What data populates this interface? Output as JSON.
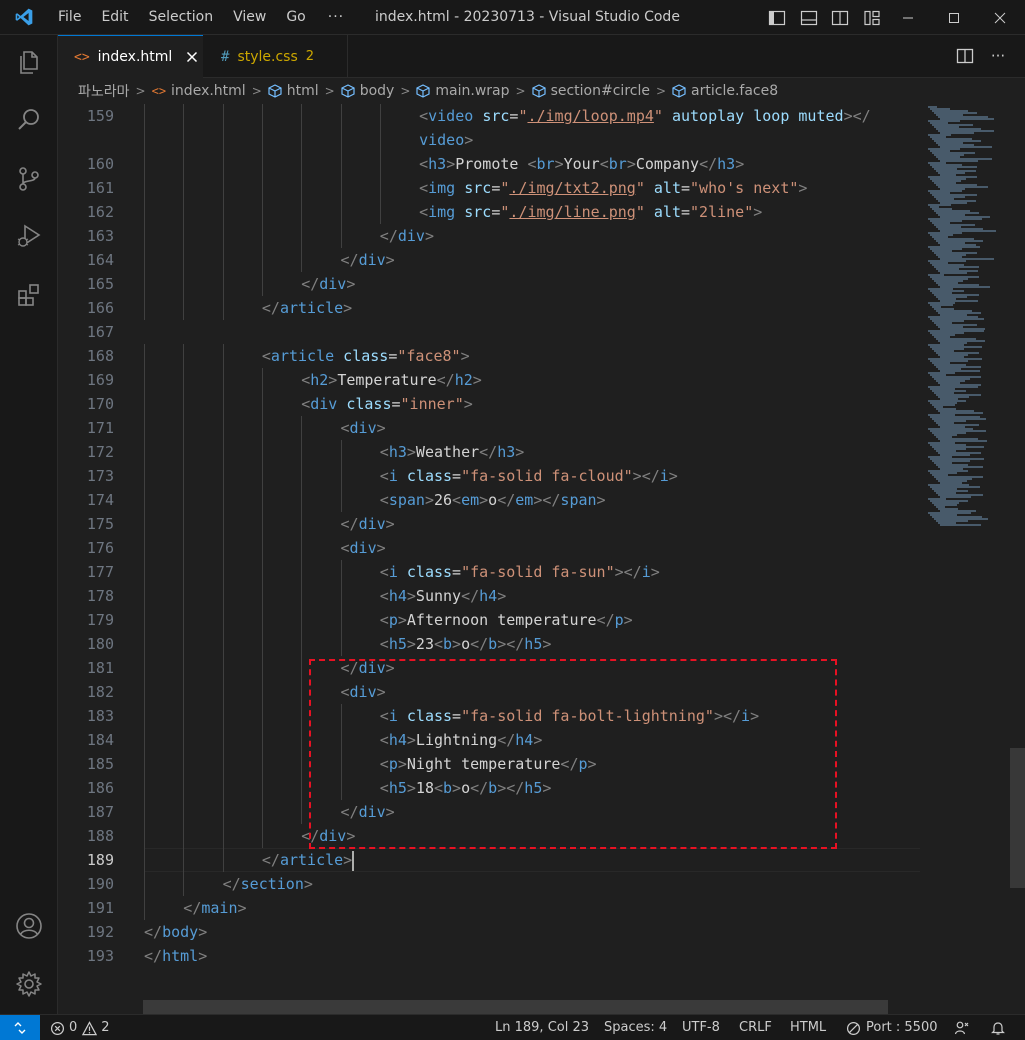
{
  "titlebar": {
    "menu": [
      "File",
      "Edit",
      "Selection",
      "View",
      "Go",
      "···"
    ],
    "title": "index.html - 20230713 - Visual Studio Code"
  },
  "tabs": [
    {
      "icon": "html-file-icon",
      "label": "index.html",
      "active": true
    },
    {
      "icon": "css-file-icon",
      "label": "style.css",
      "badge": "2",
      "active": false
    }
  ],
  "breadcrumb": [
    {
      "label": "파노라마"
    },
    {
      "label": "index.html",
      "icon": "html-file-icon"
    },
    {
      "label": "html",
      "icon": "symbol-element-icon"
    },
    {
      "label": "body",
      "icon": "symbol-element-icon"
    },
    {
      "label": "main.wrap",
      "icon": "symbol-element-icon"
    },
    {
      "label": "section#circle",
      "icon": "symbol-element-icon"
    },
    {
      "label": "article.face8",
      "icon": "symbol-element-icon"
    }
  ],
  "editor": {
    "current_line": "189",
    "lines": [
      {
        "num": "159",
        "indent": 7,
        "tokens": [
          [
            "t-br",
            "<"
          ],
          [
            "t-tag",
            "video"
          ],
          [
            "t-text",
            " "
          ],
          [
            "t-attr",
            "src"
          ],
          [
            "t-text",
            "="
          ],
          [
            "t-str",
            "\""
          ],
          [
            "t-str t-link",
            "./img/loop.mp4"
          ],
          [
            "t-str",
            "\""
          ],
          [
            "t-text",
            " "
          ],
          [
            "t-attr",
            "autoplay"
          ],
          [
            "t-text",
            " "
          ],
          [
            "t-attr",
            "loop"
          ],
          [
            "t-text",
            " "
          ],
          [
            "t-attr",
            "muted"
          ],
          [
            "t-br",
            "></"
          ]
        ]
      },
      {
        "num": "",
        "indent": 7,
        "tokens": [
          [
            "t-tag",
            "video"
          ],
          [
            "t-br",
            ">"
          ]
        ]
      },
      {
        "num": "160",
        "indent": 7,
        "tokens": [
          [
            "t-br",
            "<"
          ],
          [
            "t-tag",
            "h3"
          ],
          [
            "t-br",
            ">"
          ],
          [
            "t-text",
            "Promote "
          ],
          [
            "t-br",
            "<"
          ],
          [
            "t-tag",
            "br"
          ],
          [
            "t-br",
            ">"
          ],
          [
            "t-text",
            "Your"
          ],
          [
            "t-br",
            "<"
          ],
          [
            "t-tag",
            "br"
          ],
          [
            "t-br",
            ">"
          ],
          [
            "t-text",
            "Company"
          ],
          [
            "t-br",
            "</"
          ],
          [
            "t-tag",
            "h3"
          ],
          [
            "t-br",
            ">"
          ]
        ]
      },
      {
        "num": "161",
        "indent": 7,
        "tokens": [
          [
            "t-br",
            "<"
          ],
          [
            "t-tag",
            "img"
          ],
          [
            "t-text",
            " "
          ],
          [
            "t-attr",
            "src"
          ],
          [
            "t-text",
            "="
          ],
          [
            "t-str",
            "\""
          ],
          [
            "t-str t-link",
            "./img/txt2.png"
          ],
          [
            "t-str",
            "\""
          ],
          [
            "t-text",
            " "
          ],
          [
            "t-attr",
            "alt"
          ],
          [
            "t-text",
            "="
          ],
          [
            "t-str",
            "\"who's next\""
          ],
          [
            "t-br",
            ">"
          ]
        ]
      },
      {
        "num": "162",
        "indent": 7,
        "tokens": [
          [
            "t-br",
            "<"
          ],
          [
            "t-tag",
            "img"
          ],
          [
            "t-text",
            " "
          ],
          [
            "t-attr",
            "src"
          ],
          [
            "t-text",
            "="
          ],
          [
            "t-str",
            "\""
          ],
          [
            "t-str t-link",
            "./img/line.png"
          ],
          [
            "t-str",
            "\""
          ],
          [
            "t-text",
            " "
          ],
          [
            "t-attr",
            "alt"
          ],
          [
            "t-text",
            "="
          ],
          [
            "t-str",
            "\"2line\""
          ],
          [
            "t-br",
            ">"
          ]
        ]
      },
      {
        "num": "163",
        "indent": 6,
        "tokens": [
          [
            "t-br",
            "</"
          ],
          [
            "t-tag",
            "div"
          ],
          [
            "t-br",
            ">"
          ]
        ]
      },
      {
        "num": "164",
        "indent": 5,
        "tokens": [
          [
            "t-br",
            "</"
          ],
          [
            "t-tag",
            "div"
          ],
          [
            "t-br",
            ">"
          ]
        ]
      },
      {
        "num": "165",
        "indent": 4,
        "tokens": [
          [
            "t-br",
            "</"
          ],
          [
            "t-tag",
            "div"
          ],
          [
            "t-br",
            ">"
          ]
        ]
      },
      {
        "num": "166",
        "indent": 3,
        "tokens": [
          [
            "t-br",
            "</"
          ],
          [
            "t-tag",
            "article"
          ],
          [
            "t-br",
            ">"
          ]
        ]
      },
      {
        "num": "167",
        "indent": 0,
        "tokens": []
      },
      {
        "num": "168",
        "indent": 3,
        "tokens": [
          [
            "t-br",
            "<"
          ],
          [
            "t-tag",
            "article"
          ],
          [
            "t-text",
            " "
          ],
          [
            "t-attr",
            "class"
          ],
          [
            "t-text",
            "="
          ],
          [
            "t-str",
            "\"face8\""
          ],
          [
            "t-br",
            ">"
          ]
        ]
      },
      {
        "num": "169",
        "indent": 4,
        "tokens": [
          [
            "t-br",
            "<"
          ],
          [
            "t-tag",
            "h2"
          ],
          [
            "t-br",
            ">"
          ],
          [
            "t-text",
            "Temperature"
          ],
          [
            "t-br",
            "</"
          ],
          [
            "t-tag",
            "h2"
          ],
          [
            "t-br",
            ">"
          ]
        ]
      },
      {
        "num": "170",
        "indent": 4,
        "tokens": [
          [
            "t-br",
            "<"
          ],
          [
            "t-tag",
            "div"
          ],
          [
            "t-text",
            " "
          ],
          [
            "t-attr",
            "class"
          ],
          [
            "t-text",
            "="
          ],
          [
            "t-str",
            "\"inner\""
          ],
          [
            "t-br",
            ">"
          ]
        ]
      },
      {
        "num": "171",
        "indent": 5,
        "tokens": [
          [
            "t-br",
            "<"
          ],
          [
            "t-tag",
            "div"
          ],
          [
            "t-br",
            ">"
          ]
        ]
      },
      {
        "num": "172",
        "indent": 6,
        "tokens": [
          [
            "t-br",
            "<"
          ],
          [
            "t-tag",
            "h3"
          ],
          [
            "t-br",
            ">"
          ],
          [
            "t-text",
            "Weather"
          ],
          [
            "t-br",
            "</"
          ],
          [
            "t-tag",
            "h3"
          ],
          [
            "t-br",
            ">"
          ]
        ]
      },
      {
        "num": "173",
        "indent": 6,
        "tokens": [
          [
            "t-br",
            "<"
          ],
          [
            "t-tag",
            "i"
          ],
          [
            "t-text",
            " "
          ],
          [
            "t-attr",
            "class"
          ],
          [
            "t-text",
            "="
          ],
          [
            "t-str",
            "\"fa-solid fa-cloud\""
          ],
          [
            "t-br",
            "></"
          ],
          [
            "t-tag",
            "i"
          ],
          [
            "t-br",
            ">"
          ]
        ]
      },
      {
        "num": "174",
        "indent": 6,
        "tokens": [
          [
            "t-br",
            "<"
          ],
          [
            "t-tag",
            "span"
          ],
          [
            "t-br",
            ">"
          ],
          [
            "t-text",
            "26"
          ],
          [
            "t-br",
            "<"
          ],
          [
            "t-tag",
            "em"
          ],
          [
            "t-br",
            ">"
          ],
          [
            "t-text",
            "o"
          ],
          [
            "t-br",
            "</"
          ],
          [
            "t-tag",
            "em"
          ],
          [
            "t-br",
            "></"
          ],
          [
            "t-tag",
            "span"
          ],
          [
            "t-br",
            ">"
          ]
        ]
      },
      {
        "num": "175",
        "indent": 5,
        "tokens": [
          [
            "t-br",
            "</"
          ],
          [
            "t-tag",
            "div"
          ],
          [
            "t-br",
            ">"
          ]
        ]
      },
      {
        "num": "176",
        "indent": 5,
        "tokens": [
          [
            "t-br",
            "<"
          ],
          [
            "t-tag",
            "div"
          ],
          [
            "t-br",
            ">"
          ]
        ]
      },
      {
        "num": "177",
        "indent": 6,
        "tokens": [
          [
            "t-br",
            "<"
          ],
          [
            "t-tag",
            "i"
          ],
          [
            "t-text",
            " "
          ],
          [
            "t-attr",
            "class"
          ],
          [
            "t-text",
            "="
          ],
          [
            "t-str",
            "\"fa-solid fa-sun\""
          ],
          [
            "t-br",
            "></"
          ],
          [
            "t-tag",
            "i"
          ],
          [
            "t-br",
            ">"
          ]
        ]
      },
      {
        "num": "178",
        "indent": 6,
        "tokens": [
          [
            "t-br",
            "<"
          ],
          [
            "t-tag",
            "h4"
          ],
          [
            "t-br",
            ">"
          ],
          [
            "t-text",
            "Sunny"
          ],
          [
            "t-br",
            "</"
          ],
          [
            "t-tag",
            "h4"
          ],
          [
            "t-br",
            ">"
          ]
        ]
      },
      {
        "num": "179",
        "indent": 6,
        "tokens": [
          [
            "t-br",
            "<"
          ],
          [
            "t-tag",
            "p"
          ],
          [
            "t-br",
            ">"
          ],
          [
            "t-text",
            "Afternoon temperature"
          ],
          [
            "t-br",
            "</"
          ],
          [
            "t-tag",
            "p"
          ],
          [
            "t-br",
            ">"
          ]
        ]
      },
      {
        "num": "180",
        "indent": 6,
        "tokens": [
          [
            "t-br",
            "<"
          ],
          [
            "t-tag",
            "h5"
          ],
          [
            "t-br",
            ">"
          ],
          [
            "t-text",
            "23"
          ],
          [
            "t-br",
            "<"
          ],
          [
            "t-tag",
            "b"
          ],
          [
            "t-br",
            ">"
          ],
          [
            "t-text",
            "o"
          ],
          [
            "t-br",
            "</"
          ],
          [
            "t-tag",
            "b"
          ],
          [
            "t-br",
            "></"
          ],
          [
            "t-tag",
            "h5"
          ],
          [
            "t-br",
            ">"
          ]
        ]
      },
      {
        "num": "181",
        "indent": 5,
        "tokens": [
          [
            "t-br",
            "</"
          ],
          [
            "t-tag",
            "div"
          ],
          [
            "t-br",
            ">"
          ]
        ]
      },
      {
        "num": "182",
        "indent": 5,
        "tokens": [
          [
            "t-br",
            "<"
          ],
          [
            "t-tag",
            "div"
          ],
          [
            "t-br",
            ">"
          ]
        ]
      },
      {
        "num": "183",
        "indent": 6,
        "tokens": [
          [
            "t-br",
            "<"
          ],
          [
            "t-tag",
            "i"
          ],
          [
            "t-text",
            " "
          ],
          [
            "t-attr",
            "class"
          ],
          [
            "t-text",
            "="
          ],
          [
            "t-str",
            "\"fa-solid fa-bolt-lightning\""
          ],
          [
            "t-br",
            "></"
          ],
          [
            "t-tag",
            "i"
          ],
          [
            "t-br",
            ">"
          ]
        ]
      },
      {
        "num": "184",
        "indent": 6,
        "tokens": [
          [
            "t-br",
            "<"
          ],
          [
            "t-tag",
            "h4"
          ],
          [
            "t-br",
            ">"
          ],
          [
            "t-text",
            "Lightning"
          ],
          [
            "t-br",
            "</"
          ],
          [
            "t-tag",
            "h4"
          ],
          [
            "t-br",
            ">"
          ]
        ]
      },
      {
        "num": "185",
        "indent": 6,
        "tokens": [
          [
            "t-br",
            "<"
          ],
          [
            "t-tag",
            "p"
          ],
          [
            "t-br",
            ">"
          ],
          [
            "t-text",
            "Night temperature"
          ],
          [
            "t-br",
            "</"
          ],
          [
            "t-tag",
            "p"
          ],
          [
            "t-br",
            ">"
          ]
        ]
      },
      {
        "num": "186",
        "indent": 6,
        "tokens": [
          [
            "t-br",
            "<"
          ],
          [
            "t-tag",
            "h5"
          ],
          [
            "t-br",
            ">"
          ],
          [
            "t-text",
            "18"
          ],
          [
            "t-br",
            "<"
          ],
          [
            "t-tag",
            "b"
          ],
          [
            "t-br",
            ">"
          ],
          [
            "t-text",
            "o"
          ],
          [
            "t-br",
            "</"
          ],
          [
            "t-tag",
            "b"
          ],
          [
            "t-br",
            "></"
          ],
          [
            "t-tag",
            "h5"
          ],
          [
            "t-br",
            ">"
          ]
        ]
      },
      {
        "num": "187",
        "indent": 5,
        "tokens": [
          [
            "t-br",
            "</"
          ],
          [
            "t-tag",
            "div"
          ],
          [
            "t-br",
            ">"
          ]
        ]
      },
      {
        "num": "188",
        "indent": 4,
        "tokens": [
          [
            "t-br",
            "</"
          ],
          [
            "t-tag",
            "div"
          ],
          [
            "t-br",
            ">"
          ]
        ]
      },
      {
        "num": "189",
        "indent": 3,
        "tokens": [
          [
            "t-br",
            "</"
          ],
          [
            "t-tag",
            "article"
          ],
          [
            "t-br",
            ">"
          ]
        ]
      },
      {
        "num": "190",
        "indent": 2,
        "tokens": [
          [
            "t-br",
            "</"
          ],
          [
            "t-tag",
            "section"
          ],
          [
            "t-br",
            ">"
          ]
        ]
      },
      {
        "num": "191",
        "indent": 1,
        "tokens": [
          [
            "t-br",
            "</"
          ],
          [
            "t-tag",
            "main"
          ],
          [
            "t-br",
            ">"
          ]
        ]
      },
      {
        "num": "192",
        "indent": 0,
        "tokens": [
          [
            "t-br",
            "</"
          ],
          [
            "t-tag",
            "body"
          ],
          [
            "t-br",
            ">"
          ]
        ]
      },
      {
        "num": "193",
        "indent": 0,
        "tokens": [
          [
            "t-br",
            "</"
          ],
          [
            "t-tag",
            "html"
          ],
          [
            "t-br",
            ">"
          ]
        ]
      }
    ]
  },
  "statusbar": {
    "errors": "0",
    "warnings": "2",
    "position": "Ln 189, Col 23",
    "spaces": "Spaces: 4",
    "encoding": "UTF-8",
    "eol": "CRLF",
    "language": "HTML",
    "port": "Port : 5500"
  },
  "colors": {
    "accent": "#0078d4",
    "highlight_box": "#e81123",
    "tag": "#569cd6",
    "attr": "#9cdcfe",
    "string": "#ce9178"
  }
}
